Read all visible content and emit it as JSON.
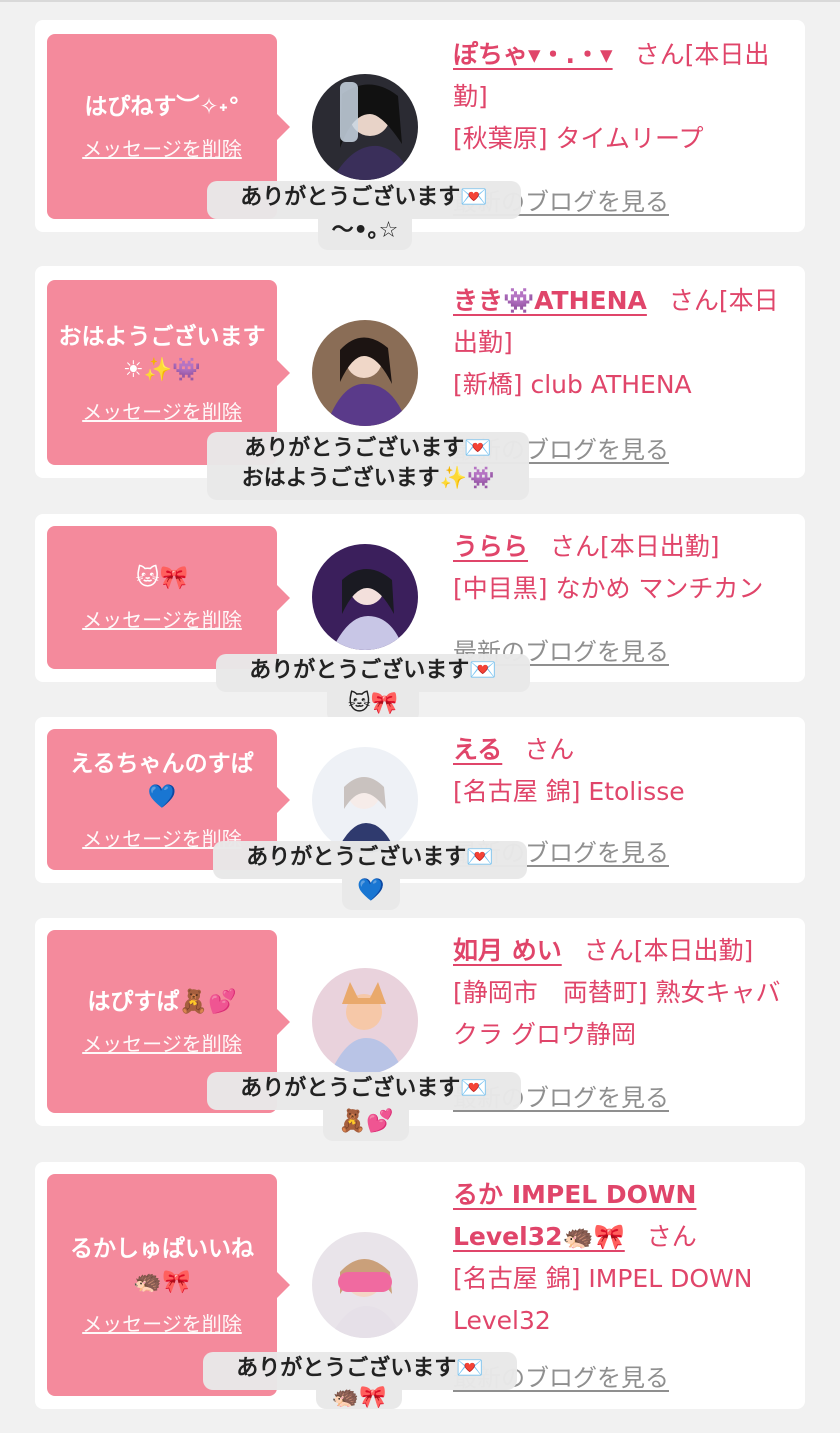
{
  "common": {
    "delete_label": "メッセージを削除",
    "blog_label": "最新のブログを見る",
    "san": "さん"
  },
  "cards": [
    {
      "message": "はぴねす︶✧˖°",
      "name": "ぽちゃ▾・.・▾",
      "san_suffix": "[本日出勤]",
      "shop": "[秋葉原] タイムリープ",
      "tooltip_line1": "ありがとうございます💌",
      "tooltip_line2": "〜•｡☆"
    },
    {
      "message": "おはようございます☀︎✨👾",
      "name": "きき👾ATHENA",
      "san_suffix": "[本日出勤]",
      "shop": "[新橋] club ATHENA",
      "tooltip_line1": "ありがとうございます💌",
      "tooltip_line2": "おはようございます✨👾"
    },
    {
      "message": "🐱🎀",
      "name": "うらら",
      "san_suffix": "[本日出勤]",
      "shop": "[中目黒] なかめ マンチカン",
      "tooltip_line1": "ありがとうございます💌",
      "tooltip_line2": "🐱🎀"
    },
    {
      "message": "えるちゃんのすぱ💙",
      "name": "える",
      "san_suffix": "",
      "shop": "[名古屋 錦] Etolisse",
      "tooltip_line1": "ありがとうございます💌",
      "tooltip_line2": "💙"
    },
    {
      "message": "はぴすぱ🧸💕",
      "name": "如月 めい",
      "san_suffix": "[本日出勤]",
      "shop": "[静岡市　両替町] 熟女キャバクラ グロウ静岡",
      "tooltip_line1": "ありがとうございます💌",
      "tooltip_line2": "🧸💕"
    },
    {
      "message": "るかしゅぱいいね🦔🎀",
      "name": "るか IMPEL DOWN Level32🦔🎀",
      "san_suffix": "",
      "shop": "[名古屋 錦] IMPEL DOWN Level32",
      "tooltip_line1": "ありがとうございます💌",
      "tooltip_line2": "🦔🎀"
    }
  ]
}
